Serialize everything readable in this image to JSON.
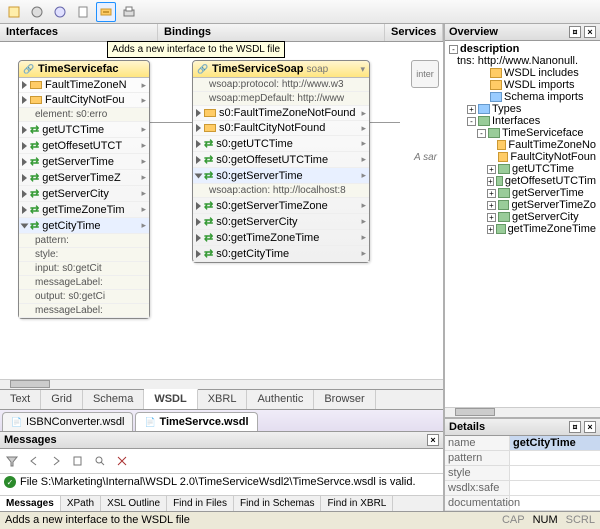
{
  "tooltip": "Adds a new interface to the WSDL file",
  "columns": {
    "interfaces": "Interfaces",
    "bindings": "Bindings",
    "services": "Services"
  },
  "interface_shape": {
    "title": "TimeServicefac",
    "rows": [
      {
        "type": "msg",
        "label": "FaultTimeZoneN"
      },
      {
        "type": "msg",
        "label": "FaultCityNotFou"
      },
      {
        "type": "sub",
        "label": "element: s0:erro"
      },
      {
        "type": "op",
        "label": "getUTCTime"
      },
      {
        "type": "op",
        "label": "getOffesetUTCT"
      },
      {
        "type": "op",
        "label": "getServerTime"
      },
      {
        "type": "op",
        "label": "getServerTimeZ"
      },
      {
        "type": "op",
        "label": "getServerCity"
      },
      {
        "type": "op",
        "label": "getTimeZoneTim"
      },
      {
        "type": "op",
        "label": "getCityTime",
        "expanded": true
      },
      {
        "type": "sub",
        "label": "pattern:"
      },
      {
        "type": "sub",
        "label": "style:"
      },
      {
        "type": "sub",
        "label": "input: s0:getCit"
      },
      {
        "type": "sub",
        "label": "messageLabel:"
      },
      {
        "type": "sub",
        "label": "output: s0:getCi"
      },
      {
        "type": "sub",
        "label": "messageLabel:"
      }
    ]
  },
  "binding_shape": {
    "title": "TimeServiceSoap",
    "suffix": "soap",
    "subs": [
      "wsoap:protocol: http://www.w3",
      "wsoap:mepDefault: http://www"
    ],
    "rows": [
      {
        "type": "msg",
        "label": "s0:FaultTimeZoneNotFound"
      },
      {
        "type": "msg",
        "label": "s0:FaultCityNotFound"
      },
      {
        "type": "op",
        "label": "s0:getUTCTime"
      },
      {
        "type": "op",
        "label": "s0:getOffesetUTCTime"
      },
      {
        "type": "op",
        "label": "s0:getServerTime",
        "expanded": true
      },
      {
        "type": "sub",
        "label": "wsoap:action: http://localhost:8"
      },
      {
        "type": "op",
        "label": "s0:getServerTimeZone"
      },
      {
        "type": "op",
        "label": "s0:getServerCity"
      },
      {
        "type": "op",
        "label": "s0:getTimeZoneTime"
      },
      {
        "type": "op",
        "label": "s0:getCityTime"
      }
    ]
  },
  "service_peek": {
    "label": "inter",
    "note": "A sar"
  },
  "viewtabs": [
    "Text",
    "Grid",
    "Schema",
    "WSDL",
    "XBRL",
    "Authentic",
    "Browser"
  ],
  "viewtab_active": "WSDL",
  "filetabs": [
    {
      "label": "ISBNConverter.wsdl",
      "active": false
    },
    {
      "label": "TimeServce.wsdl",
      "active": true
    }
  ],
  "messages": {
    "title": "Messages",
    "body": "File S:\\Marketing\\Internal\\WSDL 2.0\\TimeServiceWsdl2\\TimeServce.wsdl is valid.",
    "tabs": [
      "Messages",
      "XPath",
      "XSL Outline",
      "Find in Files",
      "Find in Schemas",
      "Find in XBRL"
    ]
  },
  "overview": {
    "title": "Overview",
    "root": "description",
    "tns": "tns: http://www.Nanonull.",
    "items": [
      {
        "lvl": 2,
        "ico": "y",
        "label": "WSDL includes"
      },
      {
        "lvl": 2,
        "ico": "y",
        "label": "WSDL imports"
      },
      {
        "lvl": 2,
        "ico": "b",
        "label": "Schema imports"
      },
      {
        "lvl": 1,
        "exp": "+",
        "ico": "b",
        "label": "Types"
      },
      {
        "lvl": 1,
        "exp": "-",
        "ico": "g",
        "label": "Interfaces"
      },
      {
        "lvl": 2,
        "exp": "-",
        "ico": "g",
        "label": "TimeServiceface"
      },
      {
        "lvl": 3,
        "ico": "y",
        "label": "FaultTimeZoneNo"
      },
      {
        "lvl": 3,
        "ico": "y",
        "label": "FaultCityNotFoun"
      },
      {
        "lvl": 3,
        "exp": "+",
        "ico": "g",
        "label": "getUTCTime"
      },
      {
        "lvl": 3,
        "exp": "+",
        "ico": "g",
        "label": "getOffesetUTCTim"
      },
      {
        "lvl": 3,
        "exp": "+",
        "ico": "g",
        "label": "getServerTime"
      },
      {
        "lvl": 3,
        "exp": "+",
        "ico": "g",
        "label": "getServerTimeZo"
      },
      {
        "lvl": 3,
        "exp": "+",
        "ico": "g",
        "label": "getServerCity"
      },
      {
        "lvl": 3,
        "exp": "+",
        "ico": "g",
        "label": "getTimeZoneTime"
      }
    ]
  },
  "details": {
    "title": "Details",
    "rows": [
      {
        "k": "name",
        "v": "getCityTime",
        "hl": true
      },
      {
        "k": "pattern",
        "v": ""
      },
      {
        "k": "style",
        "v": ""
      },
      {
        "k": "wsdlx:safe",
        "v": ""
      },
      {
        "k": "documentation",
        "v": ""
      }
    ]
  },
  "status": {
    "text": "Adds a new interface to the WSDL file",
    "caps": [
      "CAP",
      "NUM",
      "SCRL"
    ]
  }
}
